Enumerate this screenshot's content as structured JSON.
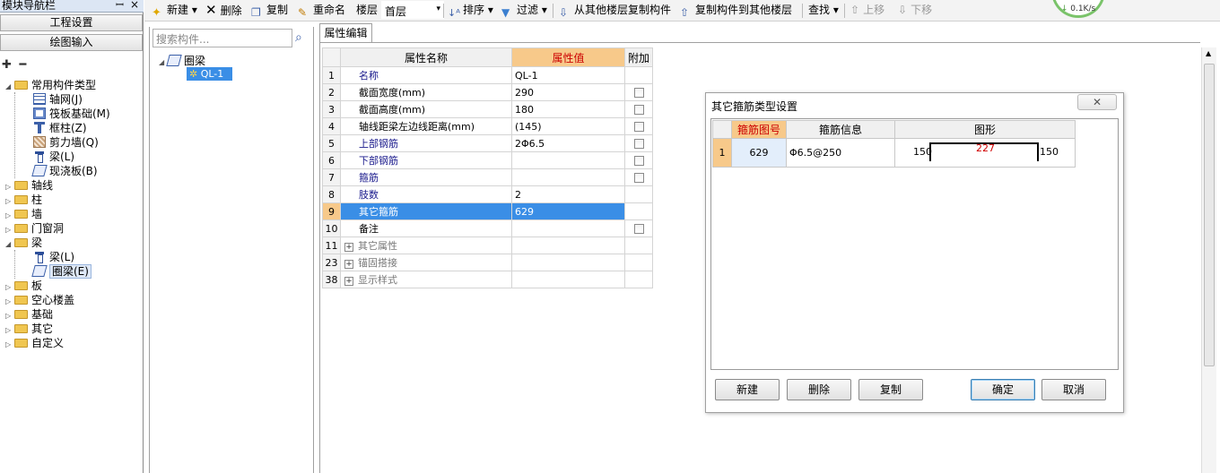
{
  "nav": {
    "title": "模块导航栏",
    "pin": "ꟷ",
    "close": "×",
    "btn_project": "工程设置",
    "btn_draw": "绘图输入",
    "tree": {
      "common": "常用构件类型",
      "axisnet": "轴网(J)",
      "raft": "筏板基础(M)",
      "frame_col": "框柱(Z)",
      "shear_wall": "剪力墙(Q)",
      "beam_l": "梁(L)",
      "slab_b": "现浇板(B)",
      "axis": "轴线",
      "column": "柱",
      "wall": "墙",
      "opening": "门窗洞",
      "beam": "梁",
      "beam_sub": "梁(L)",
      "ring_beam": "圈梁(E)",
      "board": "板",
      "hollow": "空心楼盖",
      "foundation": "基础",
      "other": "其它",
      "custom": "自定义"
    }
  },
  "toolbar": {
    "new": "新建",
    "delete": "删除",
    "copy": "复制",
    "rename": "重命名",
    "floor_label": "楼层",
    "floor_value": "首层",
    "sort": "排序",
    "filter": "过滤",
    "copy_from": "从其他楼层复制构件",
    "copy_to": "复制构件到其他楼层",
    "find": "查找",
    "move_up": "上移",
    "move_down": "下移"
  },
  "speed": "0.1K/s",
  "complist": {
    "search_placeholder": "搜索构件...",
    "root": "圈梁",
    "item": "QL-1"
  },
  "props": {
    "tab": "属性编辑",
    "col_name": "属性名称",
    "col_value": "属性值",
    "col_add": "附加",
    "rows": [
      {
        "n": "1",
        "name": "名称",
        "value": "QL-1"
      },
      {
        "n": "2",
        "name": "截面宽度(mm)",
        "value": "290"
      },
      {
        "n": "3",
        "name": "截面高度(mm)",
        "value": "180"
      },
      {
        "n": "4",
        "name": "轴线距梁左边线距离(mm)",
        "value": "(145)"
      },
      {
        "n": "5",
        "name": "上部钢筋",
        "value": "2Φ6.5"
      },
      {
        "n": "6",
        "name": "下部钢筋",
        "value": ""
      },
      {
        "n": "7",
        "name": "箍筋",
        "value": ""
      },
      {
        "n": "8",
        "name": "肢数",
        "value": "2"
      },
      {
        "n": "9",
        "name": "其它箍筋",
        "value": "629"
      },
      {
        "n": "10",
        "name": "备注",
        "value": ""
      },
      {
        "n": "11",
        "name": "其它属性",
        "value": ""
      },
      {
        "n": "23",
        "name": "锚固搭接",
        "value": ""
      },
      {
        "n": "38",
        "name": "显示样式",
        "value": ""
      }
    ]
  },
  "dialog": {
    "title": "其它箍筋类型设置",
    "close": "✕",
    "col_id": "箍筋图号",
    "col_info": "箍筋信息",
    "col_shape": "图形",
    "row": {
      "n": "1",
      "id": "629",
      "info": "Φ6.5@250",
      "left": "150",
      "mid": "227",
      "right": "150"
    },
    "btn_new": "新建",
    "btn_delete": "删除",
    "btn_copy": "复制",
    "btn_ok": "确定",
    "btn_cancel": "取消"
  }
}
